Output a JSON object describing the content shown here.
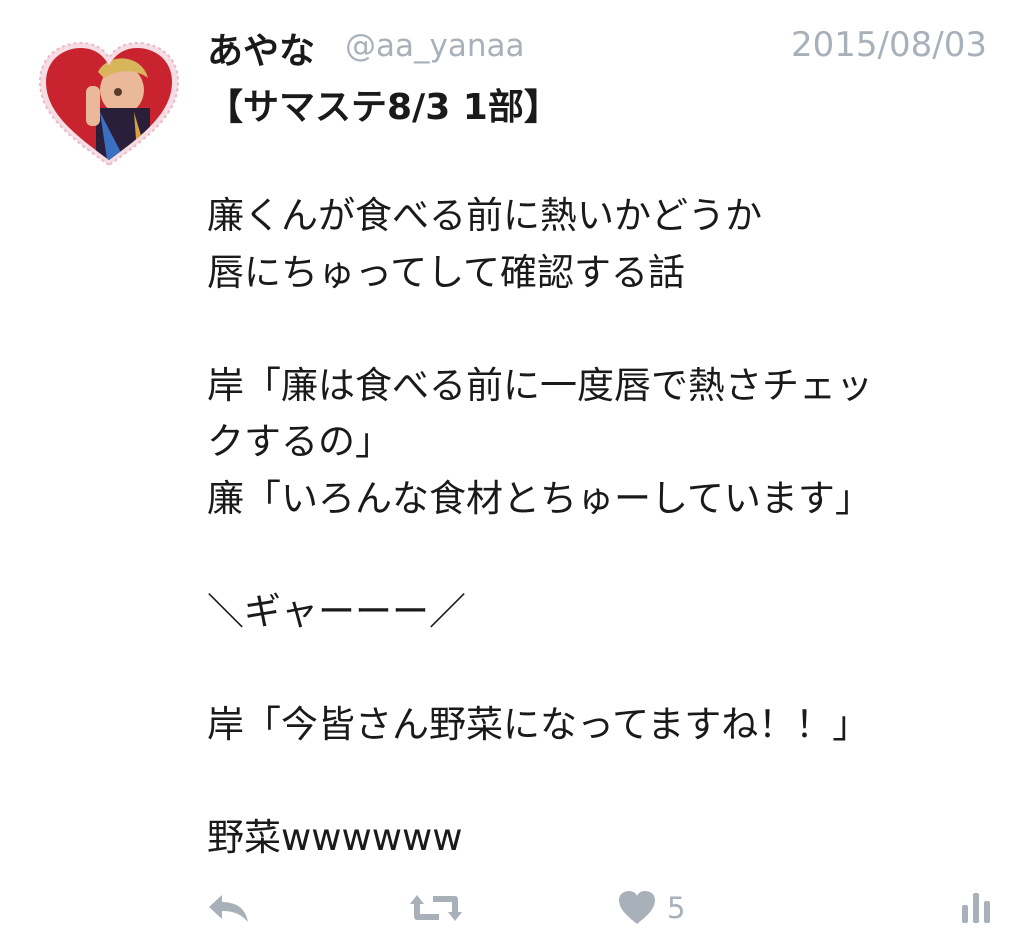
{
  "tweet": {
    "display_name": "あやな",
    "handle": "@aa_yanaa",
    "timestamp": "2015/08/03",
    "title": "【サマステ8/3 1部】",
    "body_lines": [
      "廉くんが食べる前に熱いかどうか",
      "唇にちゅってして確認する話",
      "",
      "岸「廉は食べる前に一度唇で熱さチェッ",
      "クするの」",
      "廉「いろんな食材とちゅーしています」",
      "",
      "＼ギャーーー／",
      "",
      "岸「今皆さん野菜になってますね！！」",
      "",
      "野菜wwwwww"
    ]
  },
  "actions": {
    "reply_icon": "reply-icon",
    "retweet_icon": "retweet-icon",
    "like_icon": "heart-icon",
    "like_count": "5",
    "stats_icon": "bar-chart-icon"
  },
  "colors": {
    "text": "#1a1a1a",
    "muted": "#a8b1ba",
    "heart_red": "#c8232f",
    "lace": "#f2d4dc"
  }
}
